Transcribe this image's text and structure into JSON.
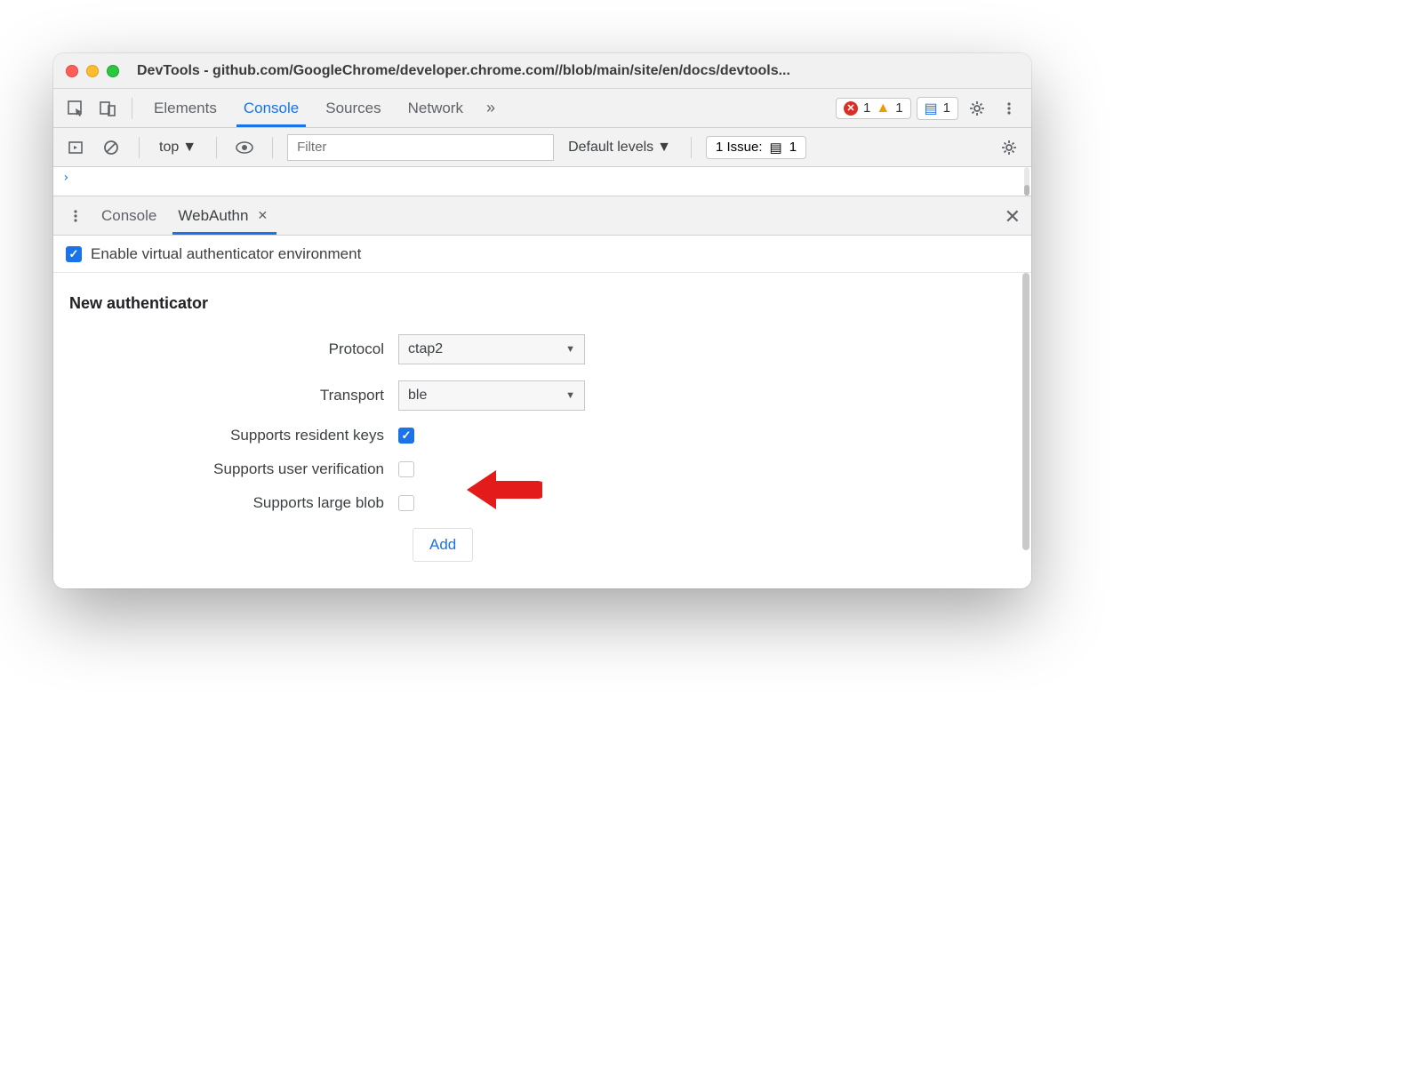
{
  "window": {
    "title": "DevTools - github.com/GoogleChrome/developer.chrome.com//blob/main/site/en/docs/devtools..."
  },
  "tabs": {
    "elements": "Elements",
    "console": "Console",
    "sources": "Sources",
    "network": "Network"
  },
  "status": {
    "errors": "1",
    "warnings": "1",
    "issues": "1"
  },
  "console_toolbar": {
    "context": "top",
    "filter_placeholder": "Filter",
    "levels": "Default levels",
    "issues_label": "1 Issue:",
    "issues_count": "1"
  },
  "console_prompt": "›",
  "drawer": {
    "tabs": {
      "console": "Console",
      "webauthn": "WebAuthn"
    },
    "enable_label": "Enable virtual authenticator environment"
  },
  "form": {
    "title": "New authenticator",
    "protocol_label": "Protocol",
    "protocol_value": "ctap2",
    "transport_label": "Transport",
    "transport_value": "ble",
    "resident_label": "Supports resident keys",
    "userverify_label": "Supports user verification",
    "largeblob_label": "Supports large blob",
    "add_label": "Add"
  }
}
